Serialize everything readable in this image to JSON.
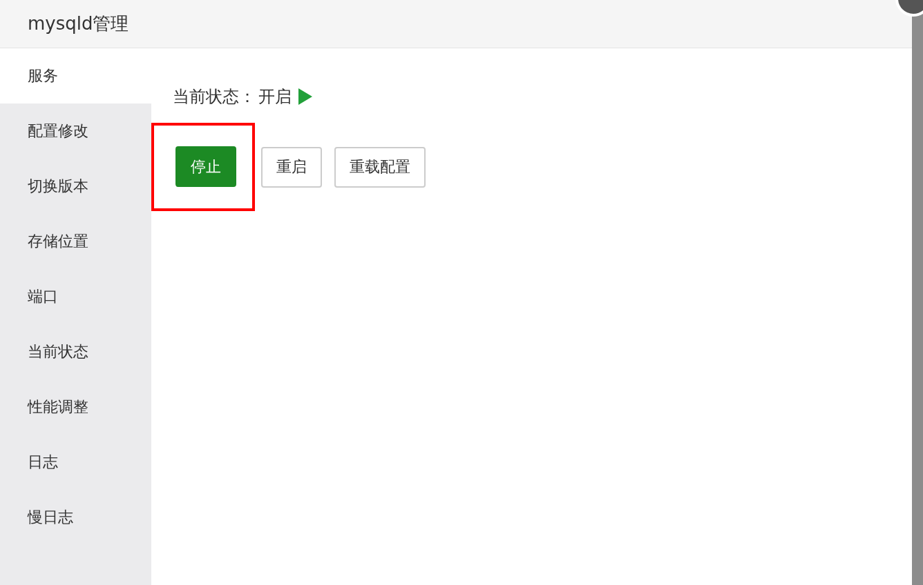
{
  "window": {
    "title": "mysqld管理"
  },
  "sidebar": {
    "items": [
      {
        "label": "服务",
        "selected": true
      },
      {
        "label": "配置修改",
        "selected": false
      },
      {
        "label": "切换版本",
        "selected": false
      },
      {
        "label": "存储位置",
        "selected": false
      },
      {
        "label": "端口",
        "selected": false
      },
      {
        "label": "当前状态",
        "selected": false
      },
      {
        "label": "性能调整",
        "selected": false
      },
      {
        "label": "日志",
        "selected": false
      },
      {
        "label": "慢日志",
        "selected": false
      }
    ]
  },
  "status": {
    "label": "当前状态：",
    "value": "开启",
    "running": true
  },
  "buttons": [
    {
      "label": "停止",
      "primary": true,
      "highlighted": true
    },
    {
      "label": "重启",
      "primary": false,
      "highlighted": false
    },
    {
      "label": "重载配置",
      "primary": false,
      "highlighted": false
    }
  ]
}
